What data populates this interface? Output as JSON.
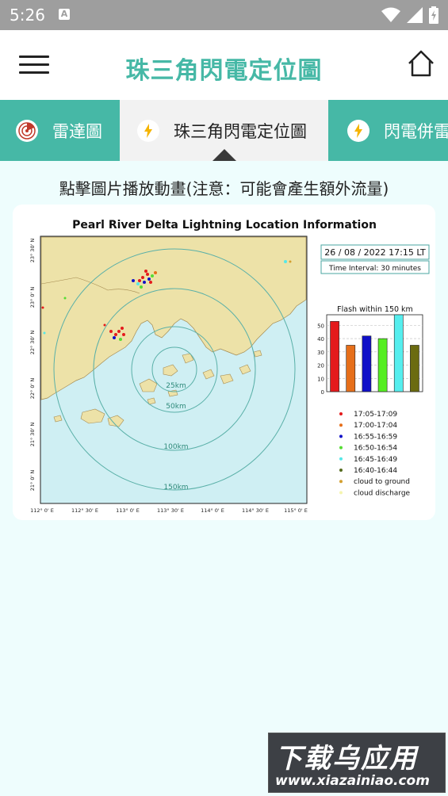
{
  "status_bar": {
    "time": "5:26",
    "notification_icon": "A"
  },
  "app_bar": {
    "title": "珠三角閃電定位圖"
  },
  "tabs": [
    {
      "label": "雷達圖",
      "icon": "radar-icon"
    },
    {
      "label": "珠三角閃電定位圖",
      "icon": "lightning-icon"
    },
    {
      "label": "閃電併雷",
      "icon": "lightning-icon"
    }
  ],
  "notice": "點擊圖片播放動畫(注意：可能會產生額外流量)",
  "figure": {
    "title": "Pearl River Delta Lightning Location Information",
    "timestamp": "26 / 08 / 2022 17:15 LT",
    "interval": "Time Interval: 30 minutes",
    "map_x_ticks": [
      "112° 0' E",
      "112° 30' E",
      "113° 0' E",
      "113° 30' E",
      "114° 0' E",
      "114° 30' E",
      "115° 0' E"
    ],
    "map_y_ticks": [
      "23° 30' N",
      "23° 0' N",
      "22° 30' N",
      "22° 0' N",
      "21° 30' N",
      "21° 0' N"
    ],
    "ring_labels": [
      "25km",
      "50km",
      "100km",
      "150km"
    ],
    "legend": [
      {
        "label": "17:05-17:09",
        "color": "#e41a1c"
      },
      {
        "label": "17:00-17:04",
        "color": "#e66f1a"
      },
      {
        "label": "16:55-16:59",
        "color": "#1010c8"
      },
      {
        "label": "16:50-16:54",
        "color": "#55dd33"
      },
      {
        "label": "16:45-16:49",
        "color": "#55e8e8"
      },
      {
        "label": "16:40-16:44",
        "color": "#556b1f"
      },
      {
        "label": "cloud to ground",
        "color": "#d4a030"
      },
      {
        "label": "cloud discharge",
        "color": "#f5f5b0"
      }
    ]
  },
  "chart_data": {
    "type": "bar",
    "title": "Flash within 150 km",
    "categories": [
      "17:05-17:09",
      "17:00-17:04",
      "16:55-16:59",
      "16:50-16:54",
      "16:45-16:49",
      "16:40-16:44"
    ],
    "values": [
      53,
      35,
      42,
      40,
      58,
      35
    ],
    "colors": [
      "#e41a1c",
      "#e66f1a",
      "#1010c8",
      "#55ee22",
      "#55eeee",
      "#6b6b10"
    ],
    "yticks": [
      0,
      10,
      20,
      30,
      40,
      50
    ],
    "ylim": [
      0,
      58
    ],
    "grid": true
  },
  "watermark": {
    "main": "下载乌应用",
    "url": "www.xiazainiao.com"
  }
}
